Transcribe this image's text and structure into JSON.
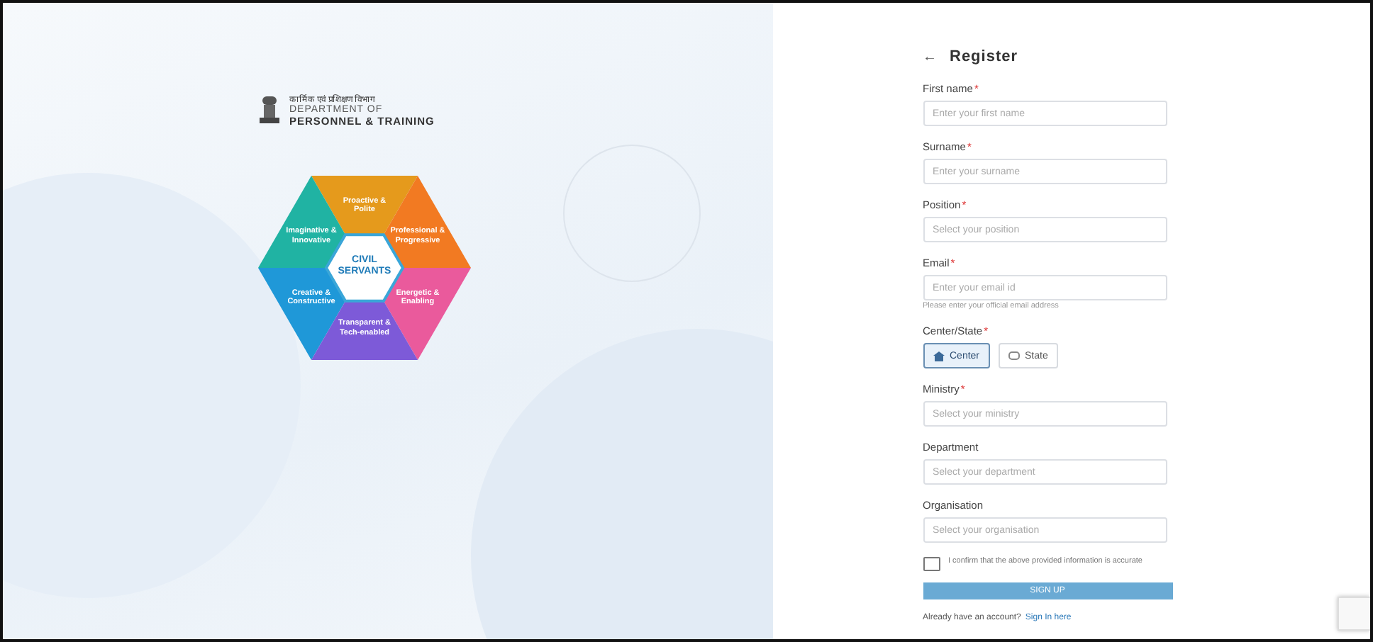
{
  "brand": {
    "hindi": "कार्मिक एवं प्रशिक्षण विभाग",
    "line_1": "DEPARTMENT OF",
    "line_2": "PERSONNEL & TRAINING"
  },
  "hexagon": {
    "center": "CIVIL SERVANTS",
    "segments": [
      {
        "kind": "top",
        "label": "Proactive & Polite",
        "color": "#e59a1c"
      },
      {
        "kind": "upper-left",
        "label": "Imaginative & Innovative",
        "color": "#20b3a3"
      },
      {
        "kind": "upper-right",
        "label": "Professional & Progressive",
        "color": "#f27a22"
      },
      {
        "kind": "lower-left",
        "label": "Creative & Constructive",
        "color": "#1f98d8"
      },
      {
        "kind": "lower-right",
        "label": "Energetic & Enabling",
        "color": "#ea5a9c"
      },
      {
        "kind": "bottom",
        "label": "Transparent & Tech-enabled",
        "color": "#7d5ad8"
      }
    ]
  },
  "form": {
    "back": "←",
    "title": "Register",
    "fields": [
      {
        "kind": "input",
        "label": "First name",
        "required_mark": "*",
        "placeholder": "Enter your first name"
      },
      {
        "kind": "input",
        "label": "Surname",
        "required_mark": "*",
        "placeholder": "Enter your surname"
      },
      {
        "kind": "input",
        "label": "Position",
        "required_mark": "*",
        "placeholder": "Select your position"
      },
      {
        "kind": "input",
        "label": "Email",
        "required_mark": "*",
        "placeholder": "Enter your email id",
        "helper": "Please enter your official email address"
      },
      {
        "kind": "choice",
        "label": "Center/State",
        "required_mark": "*",
        "options": [
          {
            "label": "Center",
            "selected": true
          },
          {
            "label": "State",
            "selected": false
          }
        ]
      },
      {
        "kind": "input",
        "label": "Ministry",
        "required_mark": "*",
        "placeholder": "Select your ministry"
      },
      {
        "kind": "input",
        "label": "Department",
        "placeholder": "Select your department"
      },
      {
        "kind": "input",
        "label": "Organisation",
        "placeholder": "Select your organisation"
      }
    ],
    "confirm": {
      "label": "I confirm that the above provided information is accurate",
      "checked": false
    },
    "submit": "SIGN UP",
    "footer": {
      "text": "Already have an account?",
      "link": "Sign In here"
    }
  }
}
